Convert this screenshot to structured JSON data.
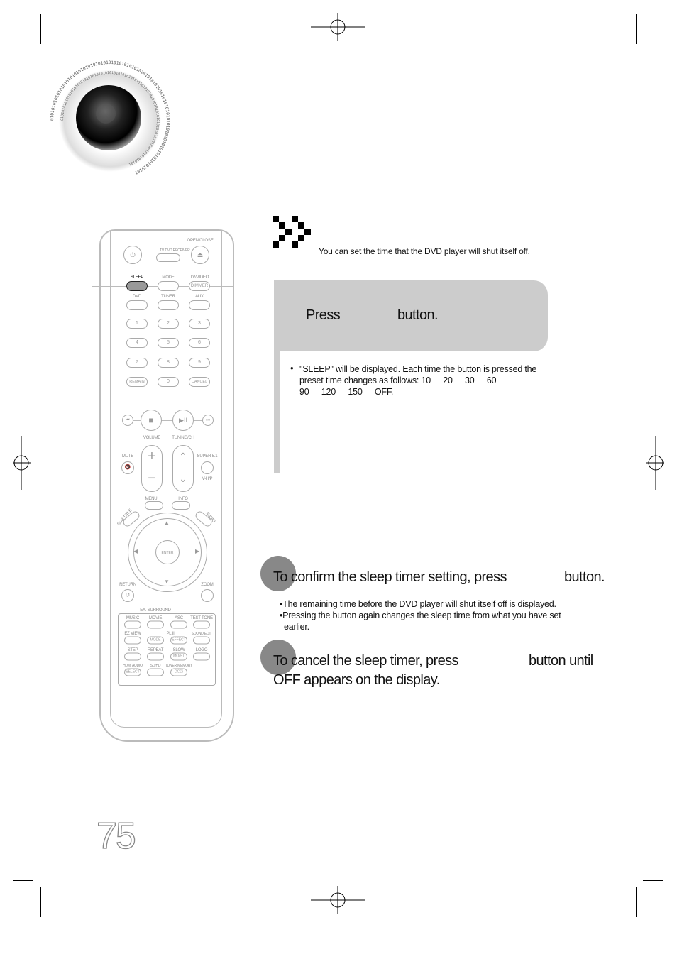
{
  "speaker_binary": "0101010101010101010101010101010101010101010101010101010101010101010101010101010101010101010101",
  "intro": "You can set the time that the DVD player will shut itself off.",
  "step1": {
    "press": "Press",
    "button": "button.",
    "note": "\"SLEEP\" will be displayed. Each time the button is pressed the preset time changes as follows: 10",
    "sequence": [
      "20",
      "30",
      "60",
      "90",
      "120",
      "150",
      "OFF."
    ]
  },
  "step2": {
    "heading_a": "To confirm the sleep timer setting, press",
    "heading_b": "button.",
    "notes": [
      "•The remaining time before the DVD player will shut itself off is displayed.",
      "•Pressing the button again changes the sleep time from what you have set",
      "earlier."
    ]
  },
  "step3": {
    "heading_a": "To cancel the sleep timer, press",
    "heading_b": "button until",
    "heading_c": "OFF appears on the display."
  },
  "page_number": "75",
  "remote": {
    "open_close": "OPEN/CLOSE",
    "tv": "TV",
    "dvd_receiver": "DVD RECEIVER",
    "sleep": "SLEEP",
    "mode": "MODE",
    "tv_video": "TV/VIDEO",
    "dimmer": "DIMMER",
    "dvd": "DVD",
    "tuner": "TUNER",
    "aux": "AUX",
    "digits": [
      "1",
      "2",
      "3",
      "4",
      "5",
      "6",
      "7",
      "8",
      "9"
    ],
    "remain": "REMAIN",
    "zero": "0",
    "cancel": "CANCEL",
    "volume": "VOLUME",
    "tuning_ch": "TUNING/CH",
    "mute": "MUTE",
    "super51": "SUPER 5.1",
    "vhp": "V-H/P",
    "menu": "MENU",
    "info": "INFO",
    "subtitle": "SUB TITLE",
    "audio": "AUDIO",
    "enter": "ENTER",
    "return": "RETURN",
    "zoom": "ZOOM",
    "ex_surround": "EX. SURROUND",
    "music": "MUSIC",
    "movie": "MOVIE",
    "asc": "ASC",
    "test_tone": "TEST TONE",
    "ez_view": "EZ VIEW",
    "pl2": "PL II",
    "mode_btn": "MODE",
    "effect": "EFFECT",
    "sound_edit": "SOUND EDIT",
    "step": "STEP",
    "repeat": "REPEAT",
    "slow": "SLOW",
    "mo_st": "MO/ST",
    "logo": "LOGO",
    "hdmi_audio": "HDMI AUDIO",
    "select": "SELECT",
    "sd_hd": "SD/HD",
    "tuner_memory": "TUNER MEMORY",
    "dcdi": "DCDi"
  },
  "colors": {
    "panel": "#cccccc",
    "step_circle": "#888888",
    "page_number": "#888888"
  }
}
